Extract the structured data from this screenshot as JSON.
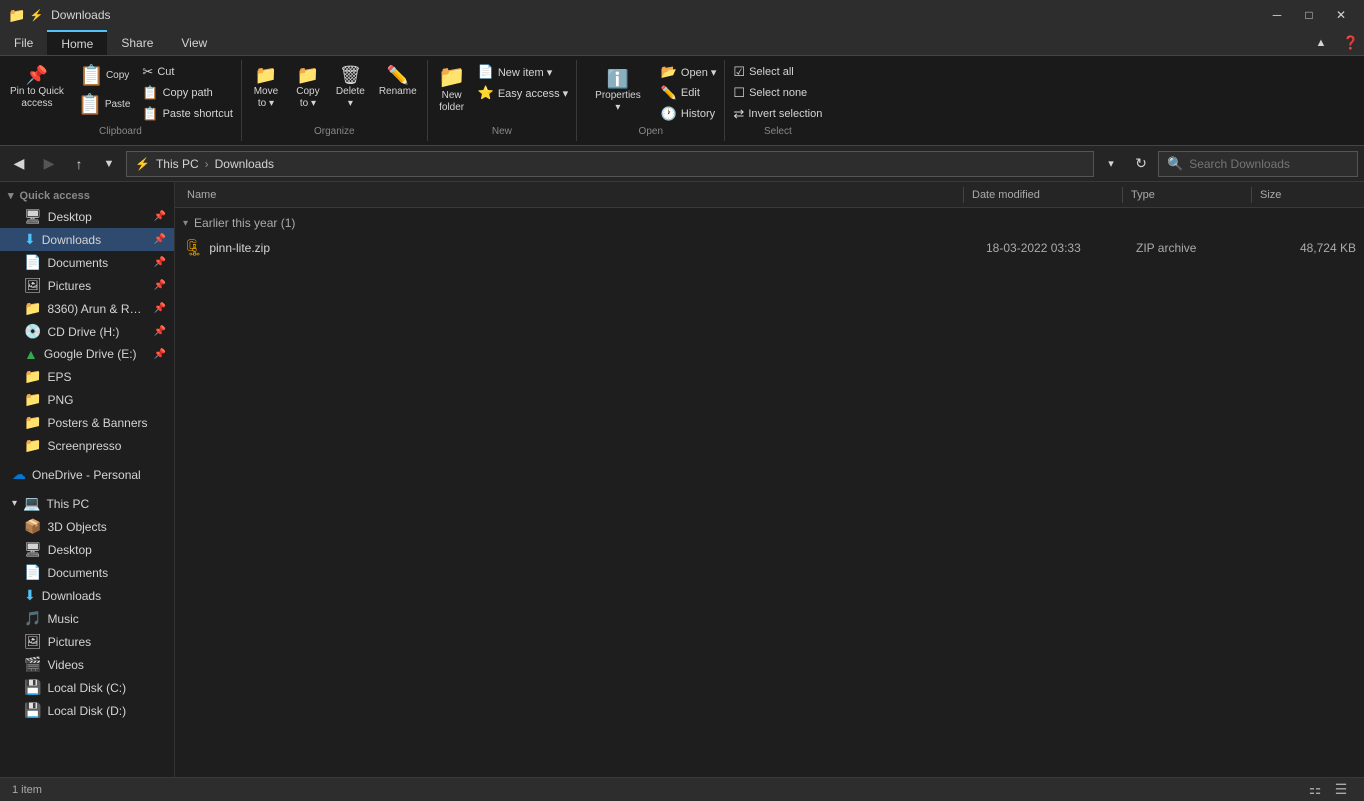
{
  "titlebar": {
    "title": "Downloads",
    "minimize_label": "─",
    "maximize_label": "□",
    "close_label": "✕"
  },
  "ribbon": {
    "tabs": [
      "File",
      "Home",
      "Share",
      "View"
    ],
    "active_tab": "Home",
    "groups": {
      "clipboard": {
        "label": "Clipboard",
        "pin_btn": {
          "icon": "📌",
          "label": "Pin to Quick\naccess"
        },
        "copy_btn": {
          "icon": "📋",
          "label": "Copy"
        },
        "paste_btn": {
          "icon": "📋",
          "label": "Paste"
        },
        "cut": "Cut",
        "copy_path": "Copy path",
        "paste_shortcut": "Paste shortcut"
      },
      "organize": {
        "label": "Organize",
        "move_btn": {
          "icon": "📁",
          "label": "Move\nto ▾"
        },
        "copy_btn": {
          "icon": "📁",
          "label": "Copy\nto ▾"
        },
        "delete_btn": {
          "icon": "🗑",
          "label": "Delete\n▾"
        },
        "rename_btn": {
          "icon": "✏",
          "label": "Rename"
        }
      },
      "new": {
        "label": "New",
        "new_folder_btn": {
          "icon": "📁",
          "label": "New\nfolder"
        },
        "new_item_btn": "New item ▾",
        "easy_access_btn": "Easy access ▾"
      },
      "open": {
        "label": "Open",
        "open_btn": "Open ▾",
        "edit_btn": "Edit",
        "history_btn": "History",
        "properties_icon": "ℹ",
        "properties_label": "Properties\n▾"
      },
      "select": {
        "label": "Select",
        "select_all": "Select all",
        "select_none": "Select none",
        "invert": "Invert selection"
      }
    }
  },
  "addressbar": {
    "back_disabled": false,
    "forward_disabled": false,
    "up_label": "↑",
    "path_parts": [
      "This PC",
      "Downloads"
    ],
    "search_placeholder": "Search Downloads"
  },
  "sidebar": {
    "quick_access_label": "Quick access",
    "items_quick": [
      {
        "name": "Desktop",
        "icon": "🖥",
        "pinned": true
      },
      {
        "name": "Downloads",
        "icon": "⬇",
        "pinned": true,
        "active": true
      },
      {
        "name": "Documents",
        "icon": "📄",
        "pinned": true
      },
      {
        "name": "Pictures",
        "icon": "🖼",
        "pinned": true
      },
      {
        "name": "8360) Arun & Raj…",
        "icon": "📁",
        "pinned": true
      },
      {
        "name": "CD Drive (H:)",
        "icon": "💿",
        "pinned": true
      },
      {
        "name": "Google Drive (E:)",
        "icon": "🖩",
        "pinned": true
      },
      {
        "name": "EPS",
        "icon": "📁",
        "pinned": false
      },
      {
        "name": "PNG",
        "icon": "📁",
        "pinned": false
      },
      {
        "name": "Posters & Banners",
        "icon": "📁",
        "pinned": false
      },
      {
        "name": "Screenpresso",
        "icon": "📁",
        "pinned": false
      }
    ],
    "onedrive_label": "OneDrive - Personal",
    "this_pc_label": "This PC",
    "items_pc": [
      {
        "name": "3D Objects",
        "icon": "📦",
        "indent": true
      },
      {
        "name": "Desktop",
        "icon": "🖥",
        "indent": true
      },
      {
        "name": "Documents",
        "icon": "📄",
        "indent": true
      },
      {
        "name": "Downloads",
        "icon": "⬇",
        "indent": true
      },
      {
        "name": "Music",
        "icon": "🎵",
        "indent": true
      },
      {
        "name": "Pictures",
        "icon": "🖼",
        "indent": true
      },
      {
        "name": "Videos",
        "icon": "🎬",
        "indent": true
      },
      {
        "name": "Local Disk (C:)",
        "icon": "💾",
        "indent": true
      },
      {
        "name": "Local Disk (D:)",
        "icon": "💾",
        "indent": true
      }
    ]
  },
  "file_list": {
    "columns": {
      "name": "Name",
      "date": "Date modified",
      "type": "Type",
      "size": "Size"
    },
    "groups": [
      {
        "label": "Earlier this year (1)",
        "items": [
          {
            "name": "pinn-lite.zip",
            "icon": "🗜",
            "date": "18-03-2022 03:33",
            "type": "ZIP archive",
            "size": "48,724 KB"
          }
        ]
      }
    ]
  },
  "statusbar": {
    "item_count": "1 item",
    "view_icons": [
      "⚏",
      "☰"
    ]
  }
}
